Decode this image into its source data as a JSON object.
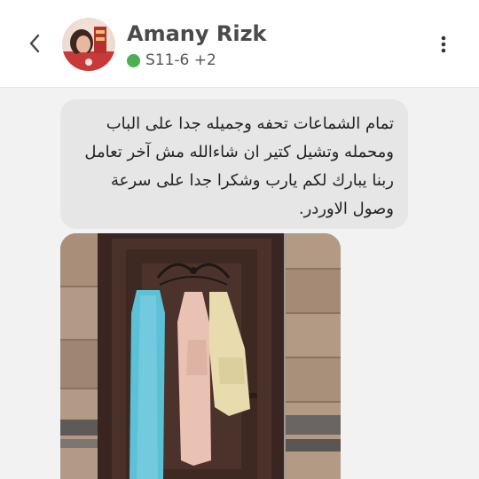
{
  "header": {
    "contact_name": "Amany Rizk",
    "status_text": "S11-6 +2",
    "status_color": "#4caf50",
    "back_icon": "chevron-left-icon",
    "more_icon": "more-vertical-icon"
  },
  "message": {
    "text": "تمام الشماعات تحفه وجميله جدا على الباب ومحمله وتشيل  كتير ان شاءالله مش آخر تعامل ربنا يبارك لكم يارب وشكرا جدا على سرعة وصول الاوردر."
  },
  "photo": {
    "subject": "image-message",
    "colors": {
      "door": "#4a3129",
      "tile": "#a88f7a",
      "towel_blue": "#5cc0d6",
      "towel_pink": "#e9c2b4",
      "towel_cream": "#e8dcae"
    }
  }
}
